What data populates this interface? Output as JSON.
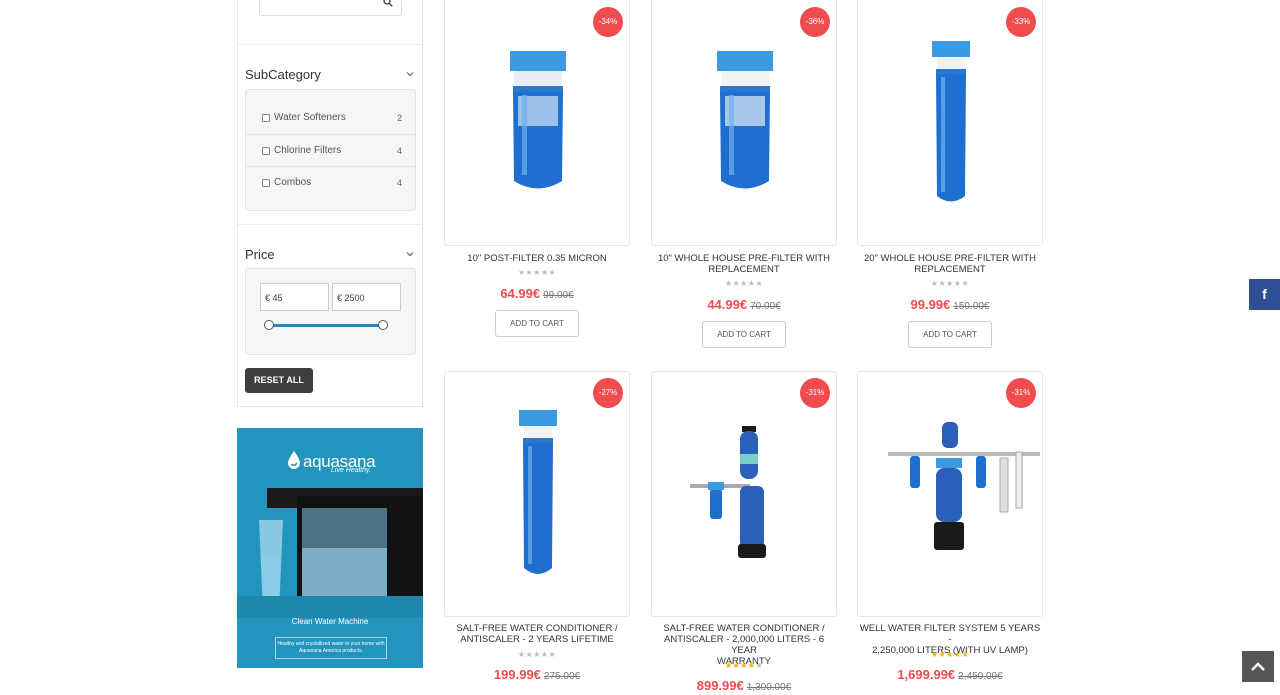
{
  "sidebar": {
    "subcategory_title": "SubCategory",
    "categories": [
      {
        "label": "Water Softeners",
        "count": "2"
      },
      {
        "label": "Chlorine Filters",
        "count": "4"
      },
      {
        "label": "Combos",
        "count": "4"
      }
    ],
    "price_title": "Price",
    "price_min": "€ 45",
    "price_max": "€ 2500",
    "reset_label": "RESET ALL"
  },
  "banner": {
    "brand": "aquasana",
    "tagline": "Live Healthy.",
    "headline": "Clean Water Machine",
    "description": "Healthy and crystallized water in your home with Aquasana America products."
  },
  "products": [
    {
      "name": "10\" POST-FILTER 0.35 MICRON",
      "name2": "",
      "badge": "-34%",
      "price": "64.99€",
      "old_price": "99.00€",
      "rating": 0,
      "cart": "ADD TO CART"
    },
    {
      "name": "10\" WHOLE HOUSE PRE-FILTER WITH",
      "name2": "REPLACEMENT",
      "badge": "-36%",
      "price": "44.99€",
      "old_price": "70.00€",
      "rating": 0,
      "cart": "ADD TO CART"
    },
    {
      "name": "20\" WHOLE HOUSE PRE-FILTER WITH",
      "name2": "REPLACEMENT",
      "badge": "-33%",
      "price": "99.99€",
      "old_price": "150.00€",
      "rating": 0,
      "cart": "ADD TO CART"
    },
    {
      "name": "SALT-FREE WATER CONDITIONER /",
      "name2": "ANTISCALER - 2 YEARS LIFETIME",
      "badge": "-27%",
      "price": "199.99€",
      "old_price": "275.00€",
      "rating": 0,
      "cart": "ADD TO CART"
    },
    {
      "name": "SALT-FREE WATER CONDITIONER /",
      "name2": "ANTISCALER - 2,000,000 LITERS - 6 YEAR",
      "name3": "WARRANTY",
      "badge": "-31%",
      "price": "899.99€",
      "old_price": "1,300.00€",
      "rating": 4,
      "cart": "ADD TO CART"
    },
    {
      "name": "WELL WATER FILTER SYSTEM 5 YEARS -",
      "name2": "2,250,000 LITERS (WITH UV LAMP)",
      "badge": "-31%",
      "price": "1,699.99€",
      "old_price": "2,450.00€",
      "rating": 5,
      "cart": "ADD TO CART"
    }
  ],
  "social": {
    "facebook_glyph": "f"
  },
  "colors": {
    "accent": "#ef4c50",
    "filter_blue": "#1f6fd0",
    "cap_blue": "#3a9be0",
    "facebook": "#2f4f95",
    "banner": "#2394be"
  },
  "icons": [
    "search-icon",
    "chevron-down-icon",
    "facebook-icon",
    "arrow-up-icon"
  ]
}
